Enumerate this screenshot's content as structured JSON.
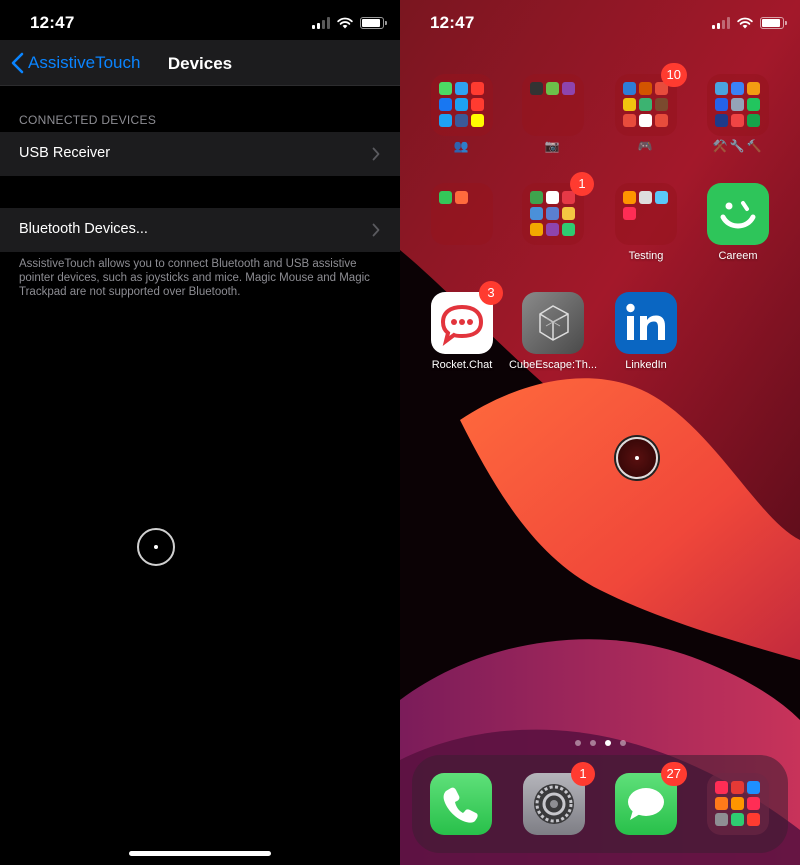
{
  "left": {
    "status": {
      "time": "12:47"
    },
    "navbar": {
      "back_label": "AssistiveTouch",
      "title": "Devices"
    },
    "section_header": "CONNECTED DEVICES",
    "cells": [
      {
        "label": "USB Receiver"
      },
      {
        "label": "Bluetooth Devices..."
      }
    ],
    "footer": "AssistiveTouch allows you to connect Bluetooth and USB assistive pointer devices, such as joysticks and mice. Magic Mouse and Magic Trackpad are not supported over Bluetooth."
  },
  "right": {
    "status": {
      "time": "12:47"
    },
    "grid": [
      {
        "type": "folder",
        "label": "👥",
        "badge": "",
        "colors": [
          "#4cd964",
          "#2ea1f2",
          "#ff3b30",
          "#1877f2",
          "#1da1f2",
          "#ff3b30",
          "#1da1f2",
          "#3b5998",
          "#fffc00"
        ]
      },
      {
        "type": "folder",
        "label": "📷",
        "badge": "",
        "colors": [
          "#333333",
          "#6cc04a",
          "#8e44ad"
        ]
      },
      {
        "type": "folder",
        "label": "🎮",
        "badge": "10",
        "colors": [
          "#2e7dd7",
          "#d35400",
          "#e74c3c",
          "#f1c40f",
          "#3cb371",
          "#7b4a2e",
          "#e74c3c",
          "#ffffff",
          "#e74c3c"
        ]
      },
      {
        "type": "folder",
        "label": "⚒️🔧🔨",
        "badge": "",
        "colors": [
          "#4aa3df",
          "#3b82f6",
          "#f39c12",
          "#2563eb",
          "#94a3b8",
          "#22c55e",
          "#1e3a8a",
          "#ef4444",
          "#16a34a"
        ]
      },
      {
        "type": "folder",
        "label": "",
        "badge": "",
        "colors": [
          "#34c759",
          "#ff6b3d"
        ]
      },
      {
        "type": "folder",
        "label": "",
        "badge": "1",
        "colors": [
          "#3fa34d",
          "#ffffff",
          "#e63946",
          "#4a90d9",
          "#5b7fd0",
          "#f4c542",
          "#f2a900",
          "#8e44ad",
          "#2ecc71"
        ]
      },
      {
        "type": "folder",
        "label": "Testing",
        "badge": "",
        "colors": [
          "#ff9500",
          "#dddddd",
          "#5ac8fa",
          "#ff2d55"
        ]
      },
      {
        "type": "app",
        "icon": "careem-icon",
        "label": "Careem",
        "badge": "",
        "color": "#2ec55a"
      },
      {
        "type": "app",
        "icon": "rocket-chat-icon",
        "label": "Rocket.Chat",
        "badge": "3",
        "color": "#ffffff"
      },
      {
        "type": "app",
        "icon": "cube-escape-icon",
        "label": "CubeEscape:Th...",
        "badge": "",
        "color": "#6b6b6b"
      },
      {
        "type": "app",
        "icon": "linkedin-icon",
        "label": "LinkedIn",
        "badge": "",
        "color": "#0a66c2"
      }
    ],
    "dock": [
      {
        "icon": "phone-icon",
        "badge": "",
        "color": "#34c759"
      },
      {
        "icon": "settings-icon",
        "badge": "1",
        "color": "#9a9aa0"
      },
      {
        "icon": "messages-icon",
        "badge": "27",
        "color": "#34c759"
      },
      {
        "type": "folder",
        "badge": "",
        "colors": [
          "#ff2d55",
          "#e53935",
          "#1e90ff",
          "#ff7a1a",
          "#ff9500",
          "#ff2d55",
          "#8e8e93",
          "#2ecc71",
          "#ff3b30"
        ]
      }
    ]
  }
}
